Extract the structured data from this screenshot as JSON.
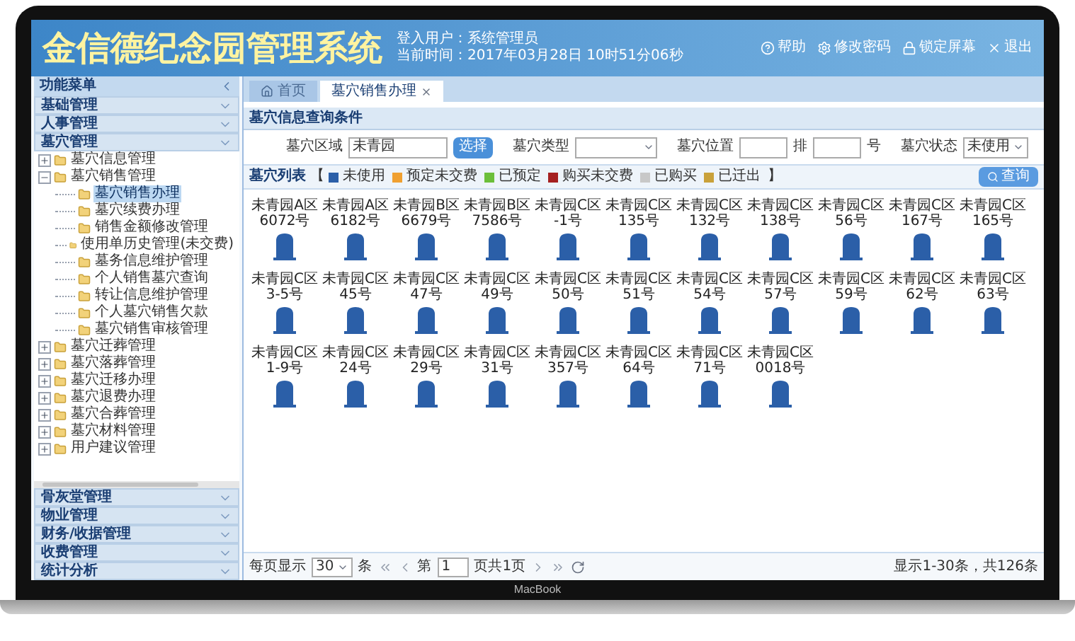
{
  "header": {
    "title": "金信德纪念园管理系统",
    "user": "登入用户：系统管理员",
    "time": "当前时间：2017年03月28日 10时51分06秒",
    "links": [
      {
        "kind": "help",
        "label": "帮助"
      },
      {
        "kind": "settings",
        "label": "修改密码"
      },
      {
        "kind": "lock",
        "label": "锁定屏幕"
      },
      {
        "kind": "close",
        "label": "退出"
      }
    ]
  },
  "sidebar": {
    "title": "功能菜单",
    "sections_top": [
      "基础管理",
      "人事管理",
      "墓穴管理"
    ],
    "tree": [
      {
        "label": "墓穴信息管理",
        "expanded": false,
        "selected": false
      },
      {
        "label": "墓穴销售管理",
        "expanded": true,
        "selected": false,
        "children": [
          {
            "label": "墓穴销售办理",
            "selected": true
          },
          {
            "label": "墓穴续费办理",
            "selected": false
          },
          {
            "label": "销售金额修改管理",
            "selected": false
          },
          {
            "label": "使用单历史管理(未交费)",
            "selected": false
          },
          {
            "label": "墓务信息维护管理",
            "selected": false
          },
          {
            "label": "个人销售墓穴查询",
            "selected": false
          },
          {
            "label": "转让信息维护管理",
            "selected": false
          },
          {
            "label": "个人墓穴销售欠款",
            "selected": false
          },
          {
            "label": "墓穴销售审核管理",
            "selected": false
          }
        ]
      },
      {
        "label": "墓穴迁葬管理",
        "expanded": false,
        "selected": false
      },
      {
        "label": "墓穴落葬管理",
        "expanded": false,
        "selected": false
      },
      {
        "label": "墓穴迁移办理",
        "expanded": false,
        "selected": false
      },
      {
        "label": "墓穴退费办理",
        "expanded": false,
        "selected": false
      },
      {
        "label": "墓穴合葬管理",
        "expanded": false,
        "selected": false
      },
      {
        "label": "墓穴材料管理",
        "expanded": false,
        "selected": false
      },
      {
        "label": "用户建议管理",
        "expanded": false,
        "selected": false
      }
    ],
    "sections_bottom": [
      "骨灰堂管理",
      "物业管理",
      "财务/收据管理",
      "收费管理",
      "统计分析"
    ]
  },
  "tabs": [
    {
      "kind": "home",
      "label": "首页",
      "selected": false
    },
    {
      "kind": "page",
      "label": "墓穴销售办理",
      "selected": true
    }
  ],
  "query": {
    "title": "墓穴信息查询条件",
    "area_label": "墓穴区域",
    "area_value": "未青园",
    "choose_button": "选择",
    "type_label": "墓穴类型",
    "position_label": "墓穴位置",
    "row_unit": "排",
    "number_unit": "号",
    "status_label": "墓穴状态",
    "status_value": "未使用"
  },
  "legend": {
    "title": "墓穴列表",
    "open": "【",
    "close": "】",
    "items": [
      {
        "label": "未使用",
        "color": "#2b5fa8"
      },
      {
        "label": "预定未交费",
        "color": "#f0a030"
      },
      {
        "label": "已预定",
        "color": "#6cbf3a"
      },
      {
        "label": "购买未交费",
        "color": "#a52020"
      },
      {
        "label": "已购买",
        "color": "#c8c8c8"
      },
      {
        "label": "已迁出",
        "color": "#c9a13a"
      }
    ],
    "search_button": "查询"
  },
  "graves": [
    {
      "area": "未青园A区",
      "number": "6072号",
      "color": "#2b5fa8"
    },
    {
      "area": "未青园A区",
      "number": "6182号",
      "color": "#2b5fa8"
    },
    {
      "area": "未青园B区",
      "number": "6679号",
      "color": "#2b5fa8"
    },
    {
      "area": "未青园B区",
      "number": "7586号",
      "color": "#2b5fa8"
    },
    {
      "area": "未青园C区",
      "number": "-1号",
      "color": "#2b5fa8"
    },
    {
      "area": "未青园C区",
      "number": "135号",
      "color": "#2b5fa8"
    },
    {
      "area": "未青园C区",
      "number": "132号",
      "color": "#2b5fa8"
    },
    {
      "area": "未青园C区",
      "number": "138号",
      "color": "#2b5fa8"
    },
    {
      "area": "未青园C区",
      "number": "56号",
      "color": "#2b5fa8"
    },
    {
      "area": "未青园C区",
      "number": "167号",
      "color": "#2b5fa8"
    },
    {
      "area": "未青园C区",
      "number": "165号",
      "color": "#2b5fa8"
    },
    {
      "area": "未青园C区",
      "number": "3-5号",
      "color": "#2b5fa8"
    },
    {
      "area": "未青园C区",
      "number": "45号",
      "color": "#2b5fa8"
    },
    {
      "area": "未青园C区",
      "number": "47号",
      "color": "#2b5fa8"
    },
    {
      "area": "未青园C区",
      "number": "49号",
      "color": "#2b5fa8"
    },
    {
      "area": "未青园C区",
      "number": "50号",
      "color": "#2b5fa8"
    },
    {
      "area": "未青园C区",
      "number": "51号",
      "color": "#2b5fa8"
    },
    {
      "area": "未青园C区",
      "number": "54号",
      "color": "#2b5fa8"
    },
    {
      "area": "未青园C区",
      "number": "57号",
      "color": "#2b5fa8"
    },
    {
      "area": "未青园C区",
      "number": "59号",
      "color": "#2b5fa8"
    },
    {
      "area": "未青园C区",
      "number": "62号",
      "color": "#2b5fa8"
    },
    {
      "area": "未青园C区",
      "number": "63号",
      "color": "#2b5fa8"
    },
    {
      "area": "未青园C区",
      "number": "1-9号",
      "color": "#2b5fa8"
    },
    {
      "area": "未青园C区",
      "number": "24号",
      "color": "#2b5fa8"
    },
    {
      "area": "未青园C区",
      "number": "29号",
      "color": "#2b5fa8"
    },
    {
      "area": "未青园C区",
      "number": "31号",
      "color": "#2b5fa8"
    },
    {
      "area": "未青园C区",
      "number": "357号",
      "color": "#2b5fa8"
    },
    {
      "area": "未青园C区",
      "number": "64号",
      "color": "#2b5fa8"
    },
    {
      "area": "未青园C区",
      "number": "71号",
      "color": "#2b5fa8"
    },
    {
      "area": "未青园C区",
      "number": "0018号",
      "color": "#2b5fa8"
    }
  ],
  "pager": {
    "per_page_label": "每页显示",
    "per_page": "30",
    "per_page_unit": "条",
    "page_prefix": "第",
    "page": "1",
    "page_suffix": "页共1页",
    "summary": "显示1-30条，共126条"
  },
  "device": {
    "label": "MacBook"
  }
}
